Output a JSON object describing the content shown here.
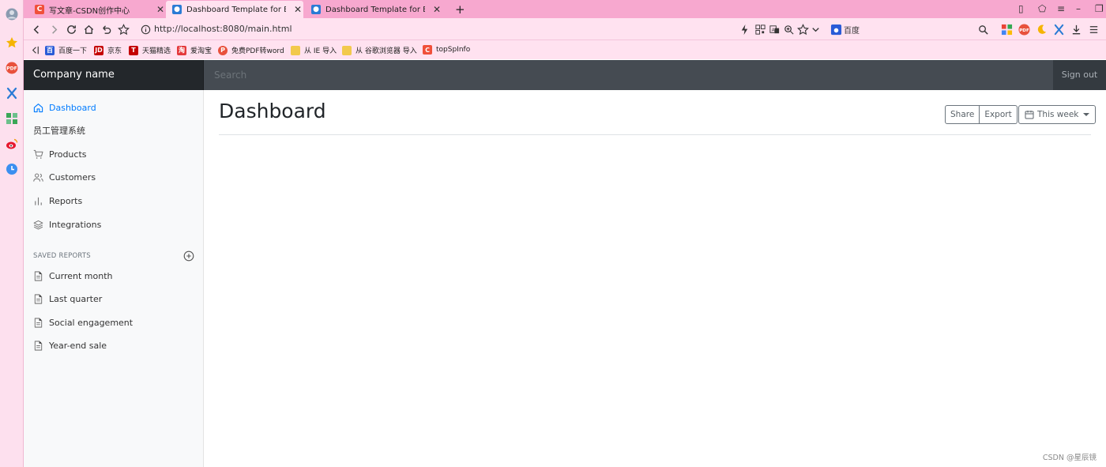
{
  "browser": {
    "tabs": [
      {
        "title": "写文章-CSDN创作中心",
        "favicon": "csdn-icon",
        "color": "#f0503a"
      },
      {
        "title": "Dashboard Template for Bootstrap",
        "favicon": "bootstrap-page-icon",
        "color": "#2a7bd5"
      },
      {
        "title": "Dashboard Template for Bootstrap",
        "favicon": "bootstrap-page-icon",
        "color": "#2a7bd5"
      }
    ],
    "new_tab_label": "+",
    "url": "http://localhost:8080/main.html",
    "search_engine": "百度",
    "bookmarks": [
      {
        "label": "百度一下",
        "color": "#2a5bd7",
        "glyph": "百"
      },
      {
        "label": "京东",
        "color": "#c40000",
        "glyph": "JD"
      },
      {
        "label": "天猫精选",
        "color": "#c40000",
        "glyph": "T"
      },
      {
        "label": "爱淘宝",
        "color": "#e4393c",
        "glyph": "淘"
      },
      {
        "label": "免费PDF转word",
        "color": "#e8513c",
        "glyph": "P"
      },
      {
        "label": "从 IE 导入",
        "color": "#f2c94c",
        "glyph": ""
      },
      {
        "label": "从 谷歌浏览器 导入",
        "color": "#f2c94c",
        "glyph": ""
      },
      {
        "label": "topSpInfo",
        "color": "#f0503a",
        "glyph": "C"
      }
    ]
  },
  "navbar": {
    "brand": "Company name",
    "search_placeholder": "Search",
    "sign_out": "Sign out"
  },
  "sidebar": {
    "items": [
      {
        "label": "Dashboard",
        "icon": "home-icon",
        "active": true
      },
      {
        "label": "员工管理系统",
        "icon": "",
        "active": false
      },
      {
        "label": "Products",
        "icon": "cart-icon",
        "active": false
      },
      {
        "label": "Customers",
        "icon": "users-icon",
        "active": false
      },
      {
        "label": "Reports",
        "icon": "bar-chart-icon",
        "active": false
      },
      {
        "label": "Integrations",
        "icon": "layers-icon",
        "active": false
      }
    ],
    "saved_heading": "SAVED REPORTS",
    "saved_items": [
      {
        "label": "Current month",
        "icon": "file-text-icon"
      },
      {
        "label": "Last quarter",
        "icon": "file-text-icon"
      },
      {
        "label": "Social engagement",
        "icon": "file-text-icon"
      },
      {
        "label": "Year-end sale",
        "icon": "file-text-icon"
      }
    ]
  },
  "main": {
    "title": "Dashboard",
    "share_label": "Share",
    "export_label": "Export",
    "period_label": "This week"
  },
  "watermark": "CSDN @星辰镜",
  "colors": {
    "accent": "#007bff",
    "navbar": "#343a40",
    "brand_bg": "#23272b",
    "browser_tabstrip": "#f7a8cf"
  }
}
